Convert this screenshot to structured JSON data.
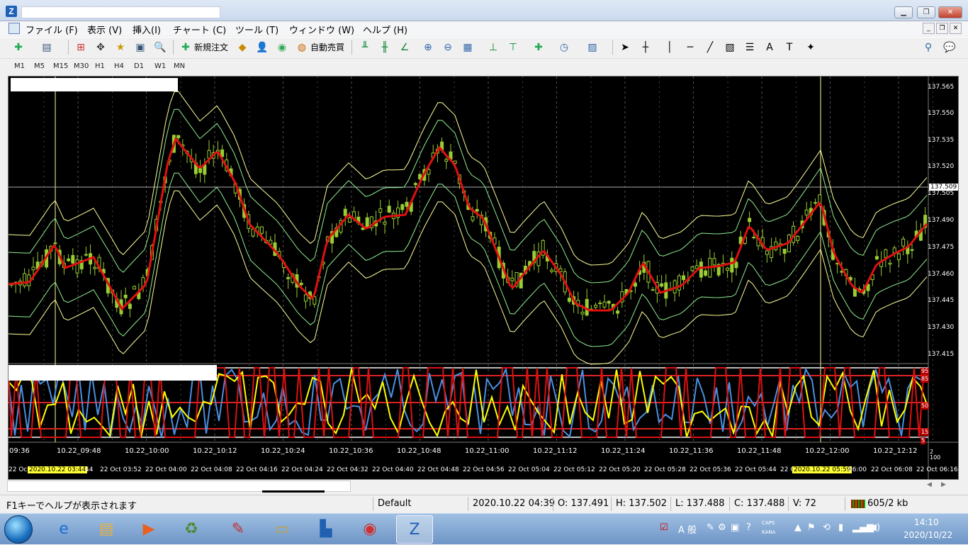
{
  "menu": [
    "ファイル (F)",
    "表示 (V)",
    "挿入(I)",
    "チャート (C)",
    "ツール (T)",
    "ウィンドウ (W)",
    "ヘルプ (H)"
  ],
  "toolbar": {
    "new_order": "新規注文",
    "auto_trade": "自動売買",
    "font_icon_label": "A"
  },
  "timeframes": [
    "M1",
    "M5",
    "M15",
    "M30",
    "H1",
    "H4",
    "D1",
    "W1",
    "MN"
  ],
  "price_axis": [
    "137.565",
    "137.550",
    "137.535",
    "137.520",
    "137.505",
    "137.490",
    "137.475",
    "137.460",
    "137.445",
    "137.430",
    "137.415"
  ],
  "current_price": "137.509",
  "osc_levels": [
    "95",
    "85",
    "50",
    "15",
    "5"
  ],
  "osc_axis_bottom": [
    "2",
    "100"
  ],
  "time_labels": [
    "09:36",
    "10.22_09:48",
    "10.22_10:00",
    "10.22_10:12",
    "10.22_10:24",
    "10.22_10:36",
    "10.22_10:48",
    "10.22_11:00",
    "10.22_11:12",
    "10.22_11:24",
    "10.22_11:36",
    "10.22_11:48",
    "10.22_12:00",
    "10.22_12:12"
  ],
  "date_labels": [
    "22 Oc",
    "2020.10.22 03:44",
    ":44",
    "22 Oct 03:52",
    "22 Oct 04:00",
    "22 Oct 04:08",
    "22 Oct 04:16",
    "22 Oct 04:24",
    "22 Oct 04:32",
    "22 Oct 04:40",
    "22 Oct 04:48",
    "22 Oct 04:56",
    "22 Oct 05:04",
    "22 Oct 05:12",
    "22 Oct 05:20",
    "22 Oct 05:28",
    "22 Oct 05:36",
    "22 Oct 05:44",
    "22 C",
    "2020.10.22 05:59",
    "06:00",
    "22 Oct 06:08",
    "22 Oct 06:16"
  ],
  "status": {
    "help": "F1キーでヘルプが表示されます",
    "profile": "Default",
    "datetime": "2020.10.22 04:39",
    "open": "O: 137.491",
    "high": "H: 137.502",
    "low": "L: 137.488",
    "close": "C: 137.488",
    "volume": "V: 72",
    "traffic": "605/2 kb"
  },
  "tray": {
    "ime": "A 般",
    "caps": "CAPS",
    "kana": "KANA",
    "time": "14:10",
    "date": "2020/10/22"
  },
  "colors": {
    "ma": "#e01010",
    "bands_outer": "#ffff99",
    "bands_inner": "#90ee90",
    "candle": "#9acd32",
    "osc_blue": "#4a90e2",
    "osc_yellow": "#ffff00",
    "osc_red": "#dd1111"
  }
}
